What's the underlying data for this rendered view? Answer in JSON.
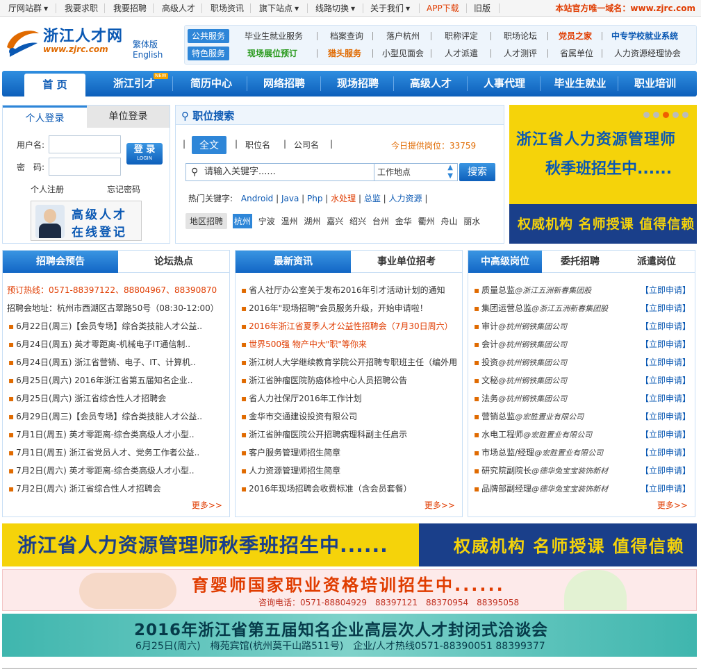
{
  "topbar": {
    "items": [
      "厅网站群",
      "我要求职",
      "我要招聘",
      "高级人才",
      "职场资讯",
      "旗下站点",
      "线路切换",
      "关于我们",
      "APP下载",
      "旧版"
    ],
    "domain_notice": "本站官方唯一域名：www.zjrc.com"
  },
  "logo": {
    "name": "浙江人才网",
    "url": "www.zjrc.com",
    "lang1": "繁体版",
    "lang2": "English"
  },
  "services": {
    "public_tag": "公共服务",
    "public_links": [
      "毕业生就业服务",
      "档案查询",
      "落户杭州",
      "职称评定",
      "职场论坛",
      "党员之家",
      "中专学校就业系统"
    ],
    "special_tag": "特色服务",
    "special_links": [
      "现场展位预订",
      "猎头服务",
      "小型见面会",
      "人才派遣",
      "人才测评",
      "省属单位",
      "人力资源经理协会"
    ]
  },
  "nav": {
    "items": [
      "首 页",
      "浙江引才",
      "简历中心",
      "网络招聘",
      "现场招聘",
      "高级人才",
      "人事代理",
      "毕业生就业",
      "职业培训"
    ],
    "new_badge": "NEW"
  },
  "login": {
    "tab_personal": "个人登录",
    "tab_company": "单位登录",
    "username_label": "用户名:",
    "password_label": "密　码:",
    "button": "登 录",
    "button_sub": "LOGIN",
    "register": "个人注册",
    "forgot": "忘记密码",
    "senior_line1": "高级人才",
    "senior_line2": "在线登记"
  },
  "search": {
    "title": "职位搜索",
    "options": [
      "全文",
      "职位名",
      "公司名"
    ],
    "today_label": "今日提供岗位：33759",
    "keyword_placeholder": "请输入关键字......",
    "location": "工作地点",
    "button": "搜索",
    "hot_label": "热门关键字:",
    "hot_keywords": [
      "Android",
      "Java",
      "Php",
      "水处理",
      "总监",
      "人力资源"
    ],
    "area_label": "地区招聘",
    "cities": [
      "杭州",
      "宁波",
      "温州",
      "湖州",
      "嘉兴",
      "绍兴",
      "台州",
      "金华",
      "衢州",
      "舟山",
      "丽水"
    ]
  },
  "banner_right": {
    "line1": "浙江省人力资源管理师",
    "line2": "秋季班招生中......",
    "bottom": "权威机构 名师授课 值得信赖"
  },
  "panel_fair": {
    "tab_active": "招聘会预告",
    "tab_other": "论坛热点",
    "hotline": "预订热线：0571-88397122、88804967、88390870",
    "address": "招聘会地址：杭州市西湖区古翠路50号（08:30-12:00）",
    "items": [
      "6月22日(周三)【会员专场】综合类技能人才公益..",
      "6月24日(周五) 英才零距离-机械电子IT通信制..",
      "6月24日(周五) 浙江省营销、电子、IT、计算机..",
      "6月25日(周六) 2016年浙江省第五届知名企业..",
      "6月25日(周六) 浙江省综合性人才招聘会",
      "6月29日(周三)【会员专场】综合类技能人才公益..",
      "7月1日(周五) 英才零距离-综合类高级人才小型..",
      "7月1日(周五) 浙江省党员人才、党务工作者公益..",
      "7月2日(周六) 英才零距离-综合类高级人才小型..",
      "7月2日(周六) 浙江省综合性人才招聘会"
    ],
    "more": "更多>>"
  },
  "panel_news": {
    "tab_active": "最新资讯",
    "tab_other": "事业单位招考",
    "items": [
      {
        "text": "省人社厅办公室关于发布2016年引才活动计划的通知",
        "color": "#333333"
      },
      {
        "text": "2016年\"现场招聘\"会员服务升级，开始申请啦！",
        "color": "#333333"
      },
      {
        "text": "2016年浙江省夏季人才公益性招聘会（7月30日周六）",
        "color": "#e03c00"
      },
      {
        "text": "世界500强 物产中大\"职\"等你来",
        "color": "#e03c00"
      },
      {
        "text": "浙江树人大学继续教育学院公开招聘专职班主任（编外用",
        "color": "#333333"
      },
      {
        "text": "浙江省肿瘤医院防癌体检中心人员招聘公告",
        "color": "#333333"
      },
      {
        "text": "省人力社保厅2016年工作计划",
        "color": "#333333"
      },
      {
        "text": "金华市交通建设投资有限公司",
        "color": "#333333"
      },
      {
        "text": "浙江省肿瘤医院公开招聘病理科副主任启示",
        "color": "#333333"
      },
      {
        "text": "客户服务管理师招生简章",
        "color": "#333333"
      },
      {
        "text": "人力资源管理师招生简章",
        "color": "#333333"
      },
      {
        "text": "2016年现场招聘会收费标准（含会员套餐）",
        "color": "#333333"
      }
    ],
    "more": "更多>>"
  },
  "panel_jobs": {
    "tab_active": "中高级岗位",
    "tab_other1": "委托招聘",
    "tab_other2": "派遣岗位",
    "apply": "【立即申请】",
    "items": [
      {
        "job": "质量总监",
        "company": "@浙江五洲新春集团股"
      },
      {
        "job": "集团运营总监",
        "company": "@浙江五洲新春集团股"
      },
      {
        "job": "审计",
        "company": "@杭州钢铁集团公司"
      },
      {
        "job": "会计",
        "company": "@杭州钢铁集团公司"
      },
      {
        "job": "投资",
        "company": "@杭州钢铁集团公司"
      },
      {
        "job": "文秘",
        "company": "@杭州钢铁集团公司"
      },
      {
        "job": "法务",
        "company": "@杭州钢铁集团公司"
      },
      {
        "job": "营销总监",
        "company": "@宏胜置业有限公司"
      },
      {
        "job": "水电工程师",
        "company": "@宏胜置业有限公司"
      },
      {
        "job": "市场总监/经理",
        "company": "@宏胜置业有限公司"
      },
      {
        "job": "研究院副院长",
        "company": "@德华兔宝宝装饰新材"
      },
      {
        "job": "品牌部副经理",
        "company": "@德华兔宝宝装饰新材"
      }
    ],
    "more": "更多>>"
  },
  "wide1": {
    "left": "浙江省人力资源管理师秋季班招生中......",
    "right": "权威机构 名师授课 值得信赖"
  },
  "wide2": {
    "title": "育婴师国家职业资格培训招生中......",
    "phone": "咨询电话：0571-88804929　88397121　88370954　88395058"
  },
  "wide3": {
    "title": "2016年浙江省第五届知名企业高层次人才封闭式洽谈会",
    "sub": "6月25日(周六)　梅苑宾馆(杭州莫干山路511号)　企业/人才热线0571-88390051 88399377"
  }
}
